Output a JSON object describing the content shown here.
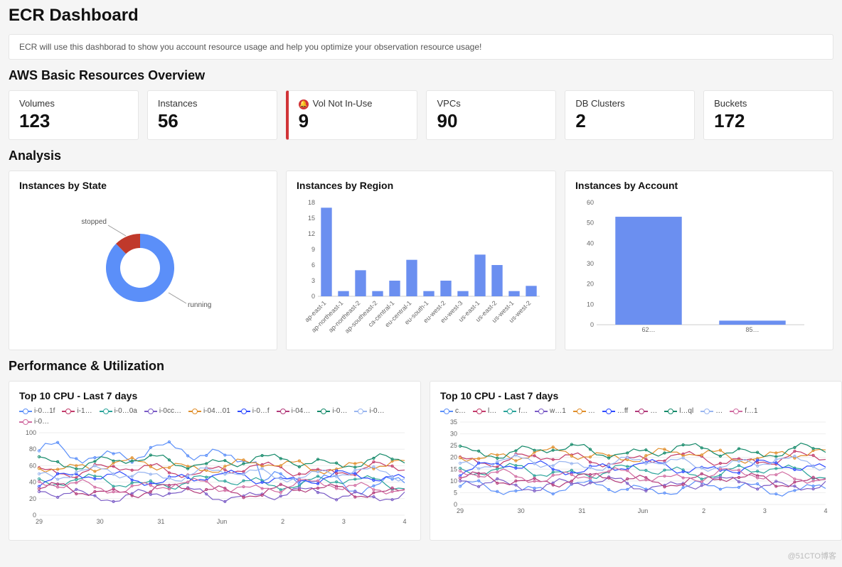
{
  "page_title": "ECR Dashboard",
  "banner": "ECR will use this dashborad to show you account resource usage and help you optimize your observation resource usage!",
  "section_overview": "AWS Basic Resources Overview",
  "section_analysis": "Analysis",
  "section_perf": "Performance & Utilization",
  "cards": [
    {
      "label": "Volumes",
      "value": "123"
    },
    {
      "label": "Instances",
      "value": "56"
    },
    {
      "label": "Vol Not In-Use",
      "value": "9",
      "alert": true
    },
    {
      "label": "VPCs",
      "value": "90"
    },
    {
      "label": "DB Clusters",
      "value": "2"
    },
    {
      "label": "Buckets",
      "value": "172"
    }
  ],
  "analysis": {
    "by_state": {
      "title": "Instances by State"
    },
    "by_region": {
      "title": "Instances by Region"
    },
    "by_account": {
      "title": "Instances by Account"
    }
  },
  "perf": {
    "left_title": "Top 10 CPU - Last 7 days",
    "right_title": "Top 10 CPU - Last 7 days"
  },
  "watermark": "@51CTO博客",
  "chart_data": [
    {
      "id": "instances_by_state",
      "type": "pie",
      "series": [
        {
          "name": "running",
          "value": 49,
          "color": "#5b8ff9"
        },
        {
          "name": "stopped",
          "value": 7,
          "color": "#c0392b"
        }
      ]
    },
    {
      "id": "instances_by_region",
      "type": "bar",
      "ylim": [
        0,
        18
      ],
      "yticks": [
        0,
        3,
        6,
        9,
        12,
        15,
        18
      ],
      "categories": [
        "ap-east-1",
        "ap-northeast-1",
        "ap-northeast-2",
        "ap-southeast-2",
        "ca-central-1",
        "eu-central-1",
        "eu-south-1",
        "eu-west-2",
        "eu-west-3",
        "us-east-1",
        "us-east-2",
        "us-west-1",
        "us-west-2"
      ],
      "values": [
        17,
        1,
        5,
        1,
        3,
        7,
        1,
        3,
        1,
        8,
        6,
        1,
        2
      ]
    },
    {
      "id": "instances_by_account",
      "type": "bar",
      "ylim": [
        0,
        60
      ],
      "yticks": [
        0,
        10,
        20,
        30,
        40,
        50,
        60
      ],
      "categories": [
        "62…",
        "85…"
      ],
      "values": [
        53,
        2
      ]
    },
    {
      "id": "top10_cpu_left",
      "type": "line",
      "ylim": [
        0,
        100
      ],
      "yticks": [
        0,
        20,
        40,
        60,
        80,
        100
      ],
      "xticks": [
        "29",
        "30",
        "31",
        "Jun",
        "2",
        "3",
        "4"
      ],
      "series": [
        {
          "name": "i-0…1f",
          "color": "#5b8ff9"
        },
        {
          "name": "i-1…",
          "color": "#c23c6b"
        },
        {
          "name": "i-0…0a",
          "color": "#2aa39a"
        },
        {
          "name": "i-0cc…",
          "color": "#7b5cc6"
        },
        {
          "name": "i-04…01",
          "color": "#e08e2b"
        },
        {
          "name": "i-0…f",
          "color": "#2f4bff"
        },
        {
          "name": "i-04…",
          "color": "#b23a7a"
        },
        {
          "name": "i-0…",
          "color": "#158a6a"
        },
        {
          "name": "i-0…",
          "color": "#9ab6f0"
        },
        {
          "name": "i-0…",
          "color": "#d06aa0"
        }
      ]
    },
    {
      "id": "top10_cpu_right",
      "type": "line",
      "ylim": [
        0,
        35
      ],
      "yticks": [
        0,
        5,
        10,
        15,
        20,
        25,
        30,
        35
      ],
      "xticks": [
        "29",
        "30",
        "31",
        "Jun",
        "2",
        "3",
        "4"
      ],
      "series": [
        {
          "name": "c…",
          "color": "#5b8ff9"
        },
        {
          "name": "l…",
          "color": "#c23c6b"
        },
        {
          "name": "f…",
          "color": "#2aa39a"
        },
        {
          "name": "w…1",
          "color": "#7b5cc6"
        },
        {
          "name": "…",
          "color": "#e08e2b"
        },
        {
          "name": "…ff",
          "color": "#2f4bff"
        },
        {
          "name": "…",
          "color": "#b23a7a"
        },
        {
          "name": "l…ql",
          "color": "#158a6a"
        },
        {
          "name": "…",
          "color": "#9ab6f0"
        },
        {
          "name": "f…1",
          "color": "#d06aa0"
        }
      ]
    }
  ]
}
